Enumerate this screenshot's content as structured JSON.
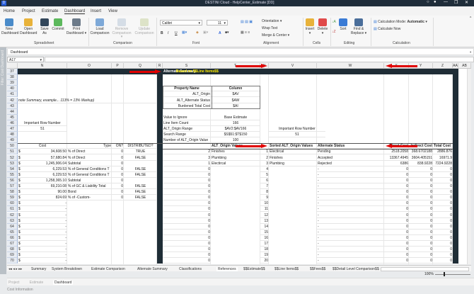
{
  "window": {
    "title": "DESTINI Cloud - HelpCenter_Estimate [DD]",
    "logo": "D",
    "controls": [
      "○",
      "●",
      "—",
      "❐",
      "✕"
    ]
  },
  "menu_tabs": [
    "Home",
    "Project",
    "Estimate",
    "Dashboard",
    "Insert",
    "View"
  ],
  "active_tab": "Dashboard",
  "ribbon": {
    "spreadsheet": {
      "label": "Spreadsheet",
      "buttons": [
        "New Dashboard",
        "Open Dashboard",
        "Save As",
        "Commit",
        "Print Dashboard ▾"
      ]
    },
    "comparison": {
      "label": "Comparison",
      "buttons": [
        "Load Comparison",
        "Remove Comparison ▾",
        "Update Comparison"
      ]
    },
    "font": {
      "label": "Font",
      "font_name": "Calibri",
      "font_size": "11",
      "bold": "B",
      "italic": "I",
      "underline": "U",
      "font_color": "A"
    },
    "alignment": {
      "label": "Alignment",
      "orientation": "Orientation ▾",
      "wrap": "Wrap Text",
      "merge": "Merge & Center ▾"
    },
    "cells": {
      "label": "Cells",
      "insert": "Insert ▾",
      "delete": "Delete ▾"
    },
    "editing": {
      "label": "Editing",
      "sort": "Sort",
      "find": "Find & Replace ▾"
    },
    "calculation": {
      "label": "Calculation",
      "mode_label": "Calculation Mode:",
      "mode_value": "Automatic",
      "calc_now": "Calculate Now"
    }
  },
  "side_strip": [
    "Cost Dashboard",
    "Filter"
  ],
  "dashboard_bar": "Dashboard",
  "name_box": "A17",
  "columns": [
    "N",
    "O",
    "P",
    "Q",
    "R",
    "S",
    "T",
    "U",
    "V",
    "W",
    "X",
    "Y",
    "Z",
    "AA",
    "AB"
  ],
  "rows": [
    {
      "r": 37,
      "c": {
        "S": "Alternate Summary",
        "T": "Based on $$Line Items$$"
      }
    },
    {
      "r": 38,
      "c": {}
    },
    {
      "r": 39,
      "c": {}
    },
    {
      "r": 40,
      "c": {
        "S": "Property Name",
        "T": "Column"
      }
    },
    {
      "r": 41,
      "c": {
        "S": "ALT_Origin",
        "T": "$AV"
      }
    },
    {
      "r": 42,
      "c": {
        "N": "note Summary, example... 113% = 13% Markup)",
        "S": "ALT_Alternate Status",
        "T": "$AW"
      }
    },
    {
      "r": 43,
      "c": {
        "S": "Burdened Total Cost",
        "T": "$AI"
      }
    },
    {
      "r": 44,
      "c": {}
    },
    {
      "r": 45,
      "c": {
        "S": "Value to Ignore",
        "T": "Base Estimate"
      }
    },
    {
      "r": 46,
      "c": {
        "N": "Important Row Number",
        "S": "Line Item Count",
        "T": "166"
      }
    },
    {
      "r": 47,
      "c": {
        "N": "51",
        "S": "ALT_Origin Range",
        "T": "$AV2:$AV166",
        "V": "Important Row Number"
      }
    },
    {
      "r": 48,
      "c": {
        "S": "Search Range",
        "T": "$S$51:$T$150",
        "V": "51"
      }
    },
    {
      "r": 49,
      "c": {
        "S": "Number of ALT_Origin Value",
        "T": "100"
      }
    },
    {
      "r": 50,
      "c": {
        "N": "Cost",
        "O": "Type",
        "P": "ON?",
        "Q": "DISTRIBUTED?",
        "T": "ALT_Origin Values",
        "V": "Sorted ALT_Origin Values",
        "W": "Alternate Status",
        "X": "Direct Cost",
        "Y": "Indirect Cost",
        "Z": "Total Cost"
      }
    },
    {
      "r": 51,
      "c": {
        "D": "$",
        "N": "34,608.50",
        "O": "% of Direct",
        "P": "0",
        "Q": "TRUE",
        "S": "2",
        "T": "Finishes",
        "U": "1",
        "V": "Electircal",
        "W": "Pending",
        "X": "2518.2058",
        "Y": "368.6702188",
        "Z": "2886.876"
      }
    },
    {
      "r": 52,
      "c": {
        "D": "$",
        "N": "57,680.84",
        "O": "% of Direct",
        "P": "0",
        "Q": "FALSE",
        "S": "3",
        "T": "Plumbing",
        "U": "2",
        "V": "Finishes",
        "W": "Accepted",
        "X": "13367.4945",
        "Y": "3604.405151",
        "Z": "16971.9"
      }
    },
    {
      "r": 53,
      "c": {
        "D": "$",
        "N": "1,245,906.04",
        "O": "Subtotal",
        "P": "0",
        "R": "0",
        "S": "1",
        "T": "Electircal",
        "U": "3",
        "V": "Plumbing",
        "W": "Rejected",
        "X": "6386",
        "Y": "838.9228",
        "Z": "7224.9228"
      }
    },
    {
      "r": 54,
      "c": {
        "D": "$",
        "N": "6,229.53",
        "O": "% of General Conditions T",
        "P": "0",
        "Q": "FALSE",
        "S": "0",
        "U": "4",
        "W": "-",
        "X": "0",
        "Y": "0",
        "Z": "0"
      }
    },
    {
      "r": 55,
      "c": {
        "D": "$",
        "N": "6,229.53",
        "O": "% of General Conditions T",
        "P": "0",
        "Q": "FALSE",
        "S": "0",
        "U": "5",
        "W": "-",
        "X": "0",
        "Y": "0",
        "Z": "0"
      }
    },
    {
      "r": 56,
      "c": {
        "D": "$",
        "N": "1,258,365.10",
        "O": "Subtotal",
        "P": "0",
        "R": "0",
        "S": "0",
        "U": "6",
        "W": "-",
        "X": "0",
        "Y": "0",
        "Z": "0"
      }
    },
    {
      "r": 57,
      "c": {
        "D": "$",
        "N": "69,210.08",
        "O": "% of GC & Liability Total",
        "P": "0",
        "Q": "FALSE",
        "S": "0",
        "U": "7",
        "W": "-",
        "X": "0",
        "Y": "0",
        "Z": "0"
      }
    },
    {
      "r": 58,
      "c": {
        "D": "$",
        "N": "90.00",
        "O": "Bond",
        "P": "0",
        "Q": "FALSE",
        "S": "0",
        "U": "8",
        "W": "-",
        "X": "0",
        "Y": "0",
        "Z": "0"
      }
    },
    {
      "r": 59,
      "c": {
        "D": "$",
        "N": "824.69",
        "O": "% of -Custom-",
        "P": "0",
        "Q": "FALSE",
        "S": "0",
        "U": "9",
        "W": "-",
        "X": "0",
        "Y": "0",
        "Z": "0"
      }
    },
    {
      "r": 60,
      "c": {
        "D": "$",
        "N": "-",
        "S": "0",
        "U": "10",
        "W": "-",
        "X": "0",
        "Y": "0",
        "Z": "0"
      }
    },
    {
      "r": 61,
      "c": {
        "D": "$",
        "N": "-",
        "S": "0",
        "U": "11",
        "W": "-",
        "X": "0",
        "Y": "0",
        "Z": "0"
      }
    },
    {
      "r": 62,
      "c": {
        "D": "$",
        "N": "-",
        "S": "0",
        "U": "12",
        "W": "-",
        "X": "0",
        "Y": "0",
        "Z": "0"
      }
    },
    {
      "r": 63,
      "c": {
        "D": "$",
        "N": "-",
        "S": "0",
        "U": "13",
        "W": "-",
        "X": "0",
        "Y": "0",
        "Z": "0"
      }
    },
    {
      "r": 64,
      "c": {
        "D": "$",
        "N": "-",
        "S": "0",
        "U": "14",
        "W": "-",
        "X": "0",
        "Y": "0",
        "Z": "0"
      }
    },
    {
      "r": 65,
      "c": {
        "D": "$",
        "N": "-",
        "S": "0",
        "U": "15",
        "W": "-",
        "X": "0",
        "Y": "0",
        "Z": "0"
      }
    },
    {
      "r": 66,
      "c": {
        "D": "$",
        "N": "-",
        "S": "0",
        "U": "16",
        "W": "-",
        "X": "0",
        "Y": "0",
        "Z": "0"
      }
    },
    {
      "r": 67,
      "c": {
        "D": "$",
        "N": "-",
        "S": "0",
        "U": "17",
        "W": "-",
        "X": "0",
        "Y": "0",
        "Z": "0"
      }
    },
    {
      "r": 68,
      "c": {
        "D": "$",
        "N": "-",
        "S": "0",
        "U": "18",
        "W": "-",
        "X": "0",
        "Y": "0",
        "Z": "0"
      }
    },
    {
      "r": 69,
      "c": {
        "D": "$",
        "N": "-",
        "S": "0",
        "U": "19",
        "W": "-",
        "X": "0",
        "Y": "0",
        "Z": "0"
      }
    },
    {
      "r": 70,
      "c": {
        "D": "$",
        "N": "-",
        "S": "0",
        "U": "20",
        "W": "-",
        "X": "0",
        "Y": "0",
        "Z": "0"
      }
    }
  ],
  "sheet_tabs": [
    "Summary",
    "System Breakdown",
    "Estimate Comparison",
    "Alternate Summary",
    "Classifications",
    "References",
    "$$Estimate$$",
    "$$Line Items$$",
    "$$Fees$$",
    "$$Detail Level Comparison$$",
    "$$Alternate Fees$$"
  ],
  "active_sheet": "References",
  "zoom": "100%",
  "bottom_tabs": [
    "Project",
    "Estimate",
    "Dashboard"
  ],
  "active_bottom_tab": "Dashboard",
  "status_text": "Cost Information",
  "colors": {
    "dark_band": "#1f2d36",
    "arrow": "#e00000",
    "highlight_text": "#ffee00",
    "accent": "#2b5fd9"
  }
}
